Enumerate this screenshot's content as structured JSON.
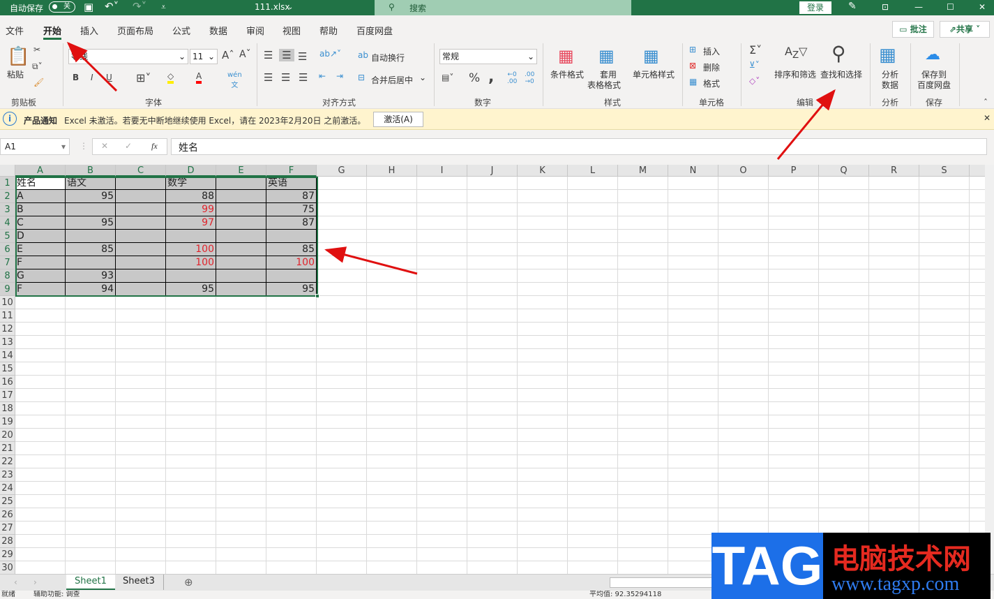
{
  "titlebar": {
    "autosave_label": "自动保存",
    "autosave_state": "关",
    "filename": "111.xlsx",
    "search_placeholder": "搜索",
    "login": "登录",
    "brand_color": "#217346"
  },
  "tabs": [
    "文件",
    "开始",
    "插入",
    "页面布局",
    "公式",
    "数据",
    "审阅",
    "视图",
    "帮助",
    "百度网盘"
  ],
  "active_tab": "开始",
  "actions": {
    "comment": "批注",
    "share": "共享"
  },
  "ribbon": {
    "clipboard": {
      "paste": "粘贴",
      "label": "剪贴板"
    },
    "font": {
      "name": "等线",
      "size": "11",
      "label": "字体",
      "bold": "B",
      "italic": "I",
      "underline": "U"
    },
    "alignment": {
      "wrap": "自动换行",
      "merge": "合并后居中",
      "label": "对齐方式"
    },
    "number": {
      "format": "常规",
      "label": "数字",
      "percent": "%",
      "comma": ","
    },
    "styles": {
      "conditional": "条件格式",
      "table_1": "套用",
      "table_2": "表格格式",
      "cell_styles": "单元格样式",
      "label": "样式"
    },
    "cells": {
      "insert": "插入",
      "delete": "删除",
      "format": "格式",
      "label": "单元格"
    },
    "editing": {
      "sort_filter": "排序和筛选",
      "find_select": "查找和选择",
      "label": "编辑"
    },
    "analysis": {
      "analyze_1": "分析",
      "analyze_2": "数据",
      "label": "分析"
    },
    "save": {
      "save_1": "保存到",
      "save_2": "百度网盘",
      "label": "保存"
    }
  },
  "notification": {
    "title": "产品通知",
    "message": "Excel 未激活。若要无中断地继续使用 Excel，请在 2023年2月20日 之前激活。",
    "button": "激活(A)"
  },
  "formula_bar": {
    "name_box": "A1",
    "fx": "fx",
    "value": "姓名"
  },
  "sheet": {
    "columns": [
      "A",
      "B",
      "C",
      "D",
      "E",
      "F",
      "G",
      "H",
      "I",
      "J",
      "K",
      "L",
      "M",
      "N",
      "O",
      "P",
      "Q",
      "R",
      "S"
    ],
    "row_count": 30,
    "selection": "A1:F9",
    "rows": [
      [
        "姓名",
        "语文",
        "",
        "数学",
        "",
        "英语"
      ],
      [
        "A",
        "95",
        "",
        "88",
        "",
        "87"
      ],
      [
        "B",
        "",
        "",
        "99",
        "",
        "75"
      ],
      [
        "C",
        "95",
        "",
        "97",
        "",
        "87"
      ],
      [
        "D",
        "",
        "",
        "",
        "",
        ""
      ],
      [
        "E",
        "85",
        "",
        "100",
        "",
        "85"
      ],
      [
        "F",
        "",
        "",
        "100",
        "",
        "100"
      ],
      [
        "G",
        "93",
        "",
        "",
        "",
        ""
      ],
      [
        "F",
        "94",
        "",
        "95",
        "",
        "95"
      ]
    ],
    "red_cells": [
      "D3",
      "D4",
      "D6",
      "D7",
      "F7"
    ],
    "red_color": "#e0242c",
    "selection_fill": "#c8c8c8"
  },
  "sheet_tabs": [
    "Sheet1",
    "Sheet3"
  ],
  "active_sheet": "Sheet1",
  "status": {
    "ready": "就绪",
    "accessibility": "辅助功能: 调查",
    "average": "平均值: 92.35294118"
  },
  "watermark": {
    "logo": "TAG",
    "text": "电脑技术网",
    "url": "www.tagxp.com"
  }
}
